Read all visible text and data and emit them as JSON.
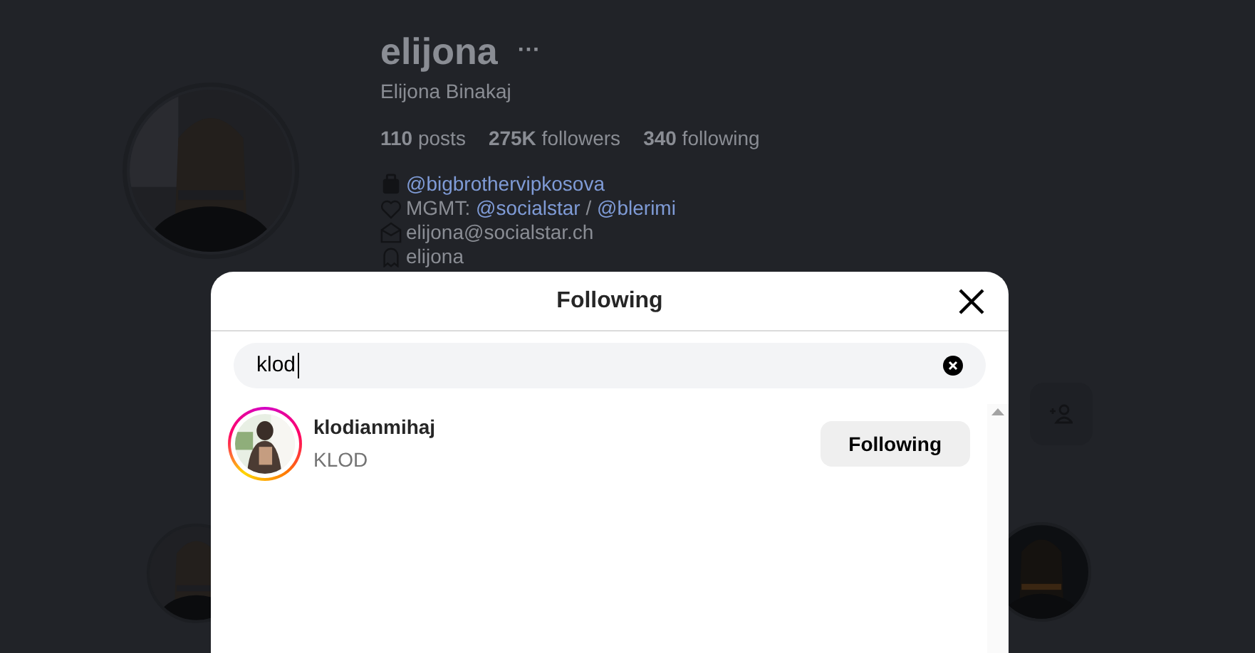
{
  "profile": {
    "username": "elijona",
    "more": "···",
    "full_name": "Elijona Binakaj",
    "stats": [
      {
        "count": "110",
        "label": "posts"
      },
      {
        "count": "275K",
        "label": "followers"
      },
      {
        "count": "340",
        "label": "following"
      }
    ],
    "bio": [
      {
        "segments": [
          {
            "kind": "link",
            "text": "@bigbrothervipkosova"
          }
        ]
      },
      {
        "segments": [
          {
            "kind": "text",
            "text": "MGMT: "
          },
          {
            "kind": "link",
            "text": "@socialstar"
          },
          {
            "kind": "text",
            "text": " / "
          },
          {
            "kind": "link",
            "text": "@blerimi"
          }
        ]
      },
      {
        "segments": [
          {
            "kind": "text",
            "text": "elijona@socialstar.ch"
          }
        ]
      },
      {
        "segments": [
          {
            "kind": "text",
            "text": "elijona"
          }
        ]
      }
    ]
  },
  "dialog": {
    "title": "Following",
    "search": {
      "value": "klod"
    },
    "results": [
      {
        "username": "klodianmihaj",
        "full_name": "KLOD",
        "button": "Following"
      }
    ]
  }
}
